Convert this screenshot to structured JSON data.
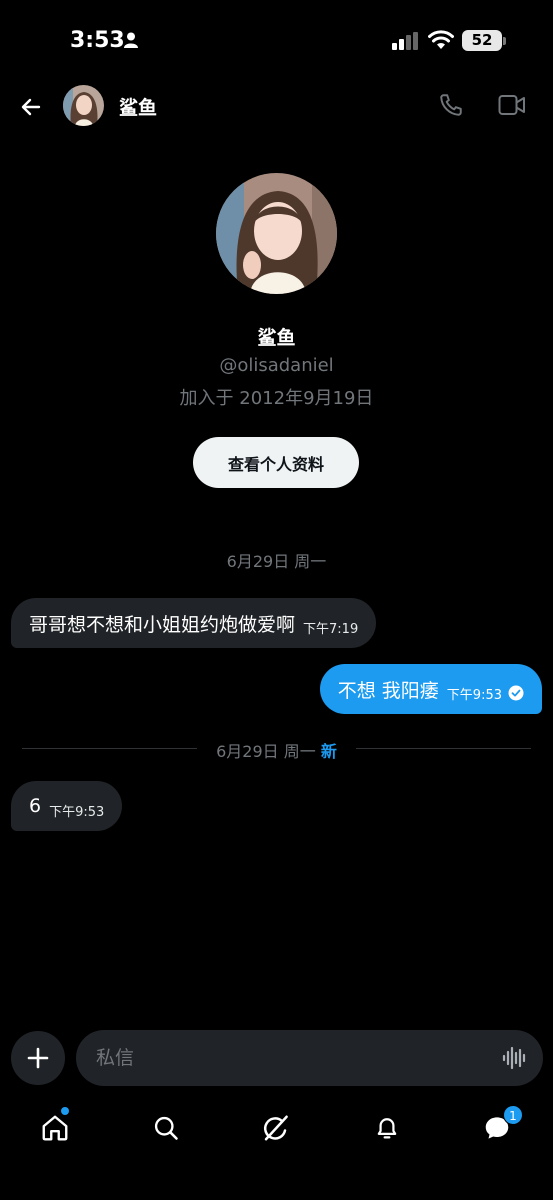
{
  "status_bar": {
    "time": "3:53",
    "battery": "52"
  },
  "header": {
    "name": "鲨鱼"
  },
  "profile": {
    "name": "鲨鱼",
    "handle": "@olisadaniel",
    "joined": "加入于 2012年9月19日",
    "view_profile_label": "查看个人资料"
  },
  "conversation": {
    "date_1": "6月29日 周一",
    "date_2": "6月29日 周一",
    "new_label": "新",
    "messages": [
      {
        "direction": "in",
        "text": "哥哥想不想和小姐姐约炮做爱啊",
        "time": "下午7:19"
      },
      {
        "direction": "out",
        "text": "不想 我阳痿",
        "time": "下午9:53",
        "status": "read"
      },
      {
        "direction": "in",
        "text": "6",
        "time": "下午9:53"
      }
    ]
  },
  "composer": {
    "placeholder": "私信"
  },
  "nav": {
    "messages_badge": "1"
  },
  "colors": {
    "accent": "#1d9bf0",
    "bubble_in": "#202327",
    "muted": "#71767b"
  }
}
